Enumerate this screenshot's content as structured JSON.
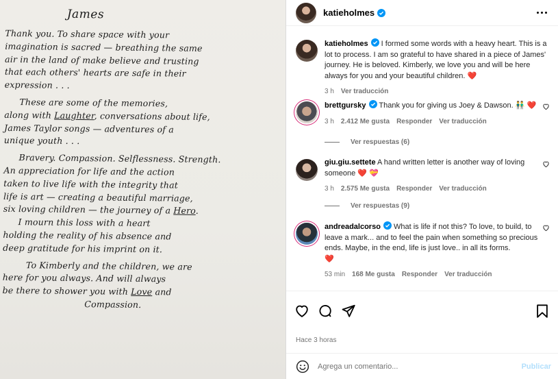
{
  "letter": {
    "title": "James",
    "lines": [
      "Thank you. To share space with your",
      "imagination is sacred — breathing the same",
      "air in the land of make believe and trusting",
      "that each others' hearts are safe in their",
      "expression . . .",
      "These are some of the memories,",
      "along with Laughter, conversations about life,",
      "James Taylor songs — adventures of a",
      "unique youth . . .",
      "Bravery. Compassion. Selflessness. Strength.",
      "An appreciation for life and the action",
      "taken to live life with the integrity that",
      "life is art — creating a beautiful marriage,",
      "six loving children — the journey of a Hero.",
      "I mourn this loss with a heart",
      "holding the reality of his absence and",
      "deep gratitude for his imprint on it.",
      "To Kimberly and the children, we are",
      "here for you always. And will always",
      "be there to shower you with Love and",
      "Compassion."
    ]
  },
  "header": {
    "username": "katieholmes"
  },
  "caption": {
    "username": "katieholmes",
    "text": " I formed some words with a heavy heart. This is a lot to process. I am so grateful to have shared in a piece of James' journey. He is beloved. Kimberly, we love you and will be here always for you and your beautiful children. ",
    "emoji": "❤️",
    "time": "3 h",
    "translate": "Ver traducción"
  },
  "comments": [
    {
      "username": "brettgursky",
      "text": " Thank you for giving us Joey & Dawson. ",
      "emoji": "👬 ❤️",
      "time": "3 h",
      "likes": "2.412 Me gusta",
      "reply": "Responder",
      "translate": "Ver traducción",
      "view_replies": "Ver respuestas (6)"
    },
    {
      "username": "giu.giu.settete",
      "text": " A hand written letter is another way of loving someone ",
      "emoji": "❤️ 💝",
      "time": "3 h",
      "likes": "2.575 Me gusta",
      "reply": "Responder",
      "translate": "Ver traducción",
      "view_replies": "Ver respuestas (9)"
    },
    {
      "username": "andreadalcorso",
      "text": " What is life if not this? To love, to build, to leave a mark... and to feel the pain when something so precious ends. Maybe, in the end, life is just love.. in all its forms.",
      "emoji": "❤️",
      "time": "53 min",
      "likes": "168 Me gusta",
      "reply": "Responder",
      "translate": "Ver traducción"
    }
  ],
  "footer": {
    "time_ago": "Hace 3 horas",
    "comment_placeholder": "Agrega un comentario...",
    "publish": "Publicar"
  },
  "colors": {
    "verified": "#0095f6",
    "heart_emoji": "#ff3b6a",
    "publish_disabled": "#b2dffc",
    "meta_text": "#737373"
  },
  "icons": [
    "more-options-icon",
    "verified-icon",
    "heart-icon",
    "comment-icon",
    "share-icon",
    "bookmark-icon",
    "emoji-icon"
  ]
}
